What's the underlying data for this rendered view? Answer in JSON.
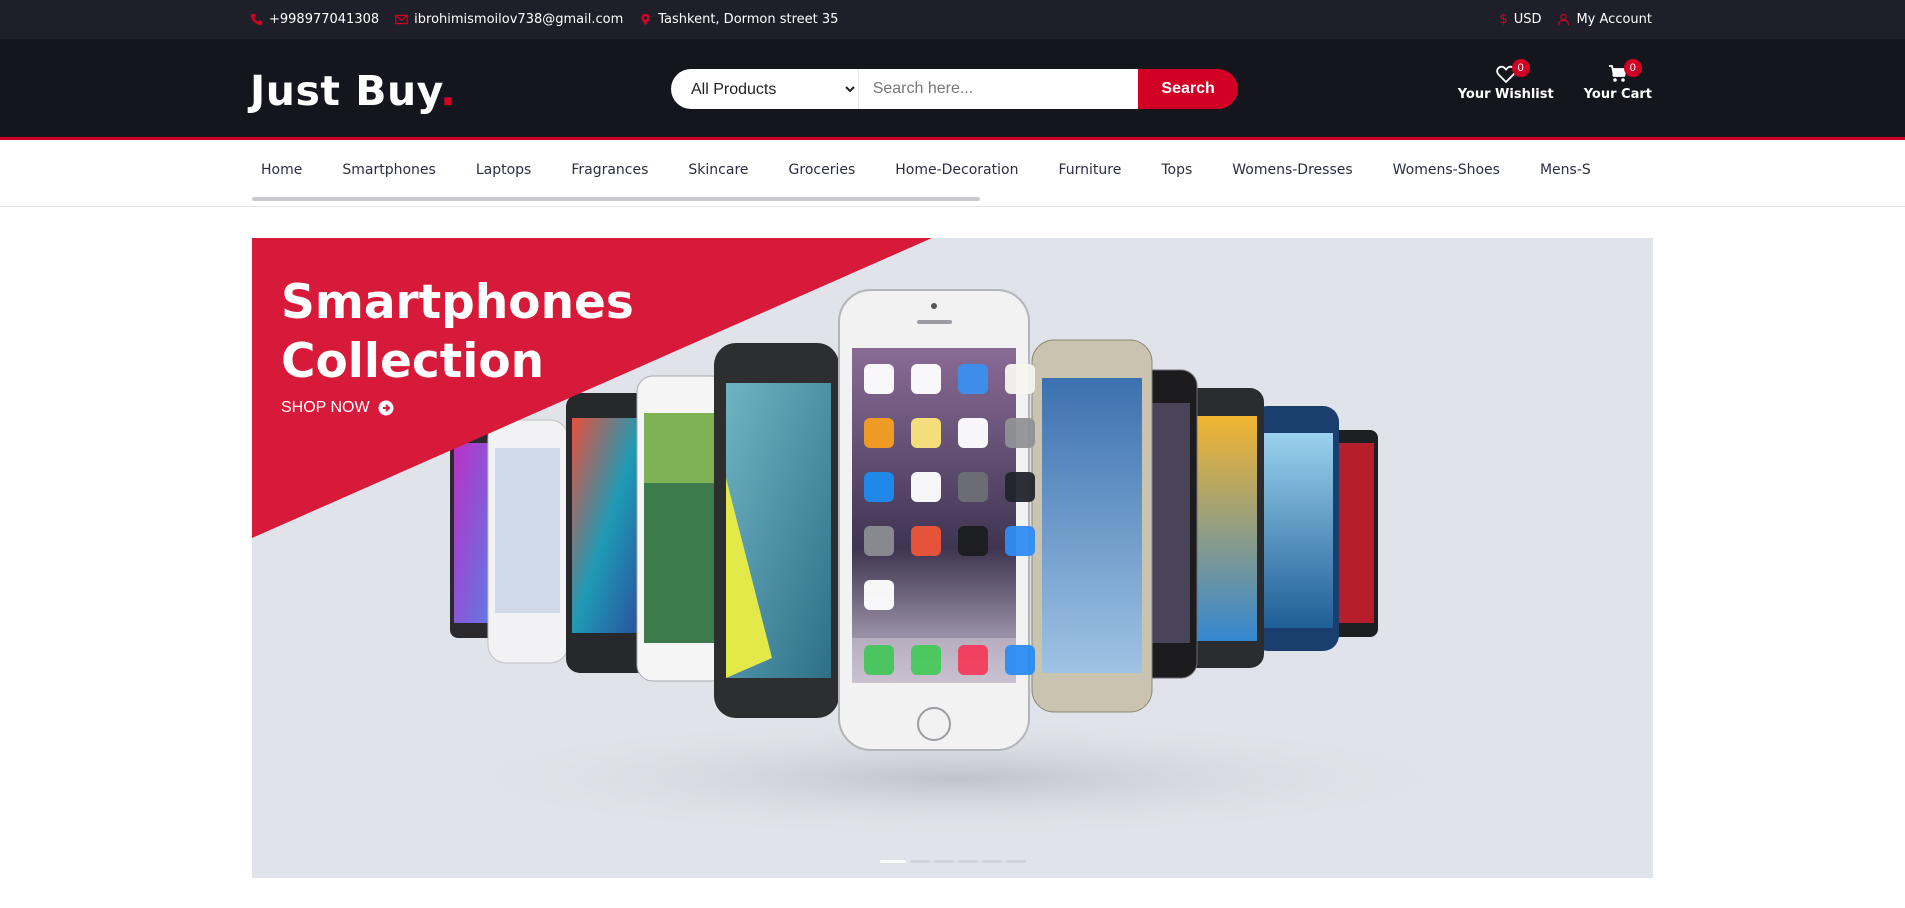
{
  "topbar": {
    "phone": "+998977041308",
    "email": "ibrohimismoilov738@gmail.com",
    "address": "Tashkent, Dormon street 35",
    "currency": "USD",
    "account": "My Account",
    "accent_color": "#d10024"
  },
  "header": {
    "logo_text": "Just Buy",
    "logo_dot": ".",
    "search_category": "All Products",
    "search_placeholder": "Search here...",
    "search_button": "Search",
    "wishlist_label": "Your Wishlist",
    "wishlist_count": "0",
    "cart_label": "Your Cart",
    "cart_count": "0"
  },
  "nav": {
    "items": [
      "Home",
      "Smartphones",
      "Laptops",
      "Fragrances",
      "Skincare",
      "Groceries",
      "Home-Decoration",
      "Furniture",
      "Tops",
      "Womens-Dresses",
      "Womens-Shoes",
      "Mens-S"
    ]
  },
  "hero": {
    "title": "Smartphones Collection",
    "cta": "SHOP NOW",
    "slide_count": 6,
    "active_slide": 1,
    "background_color": "#e1e3ea"
  }
}
